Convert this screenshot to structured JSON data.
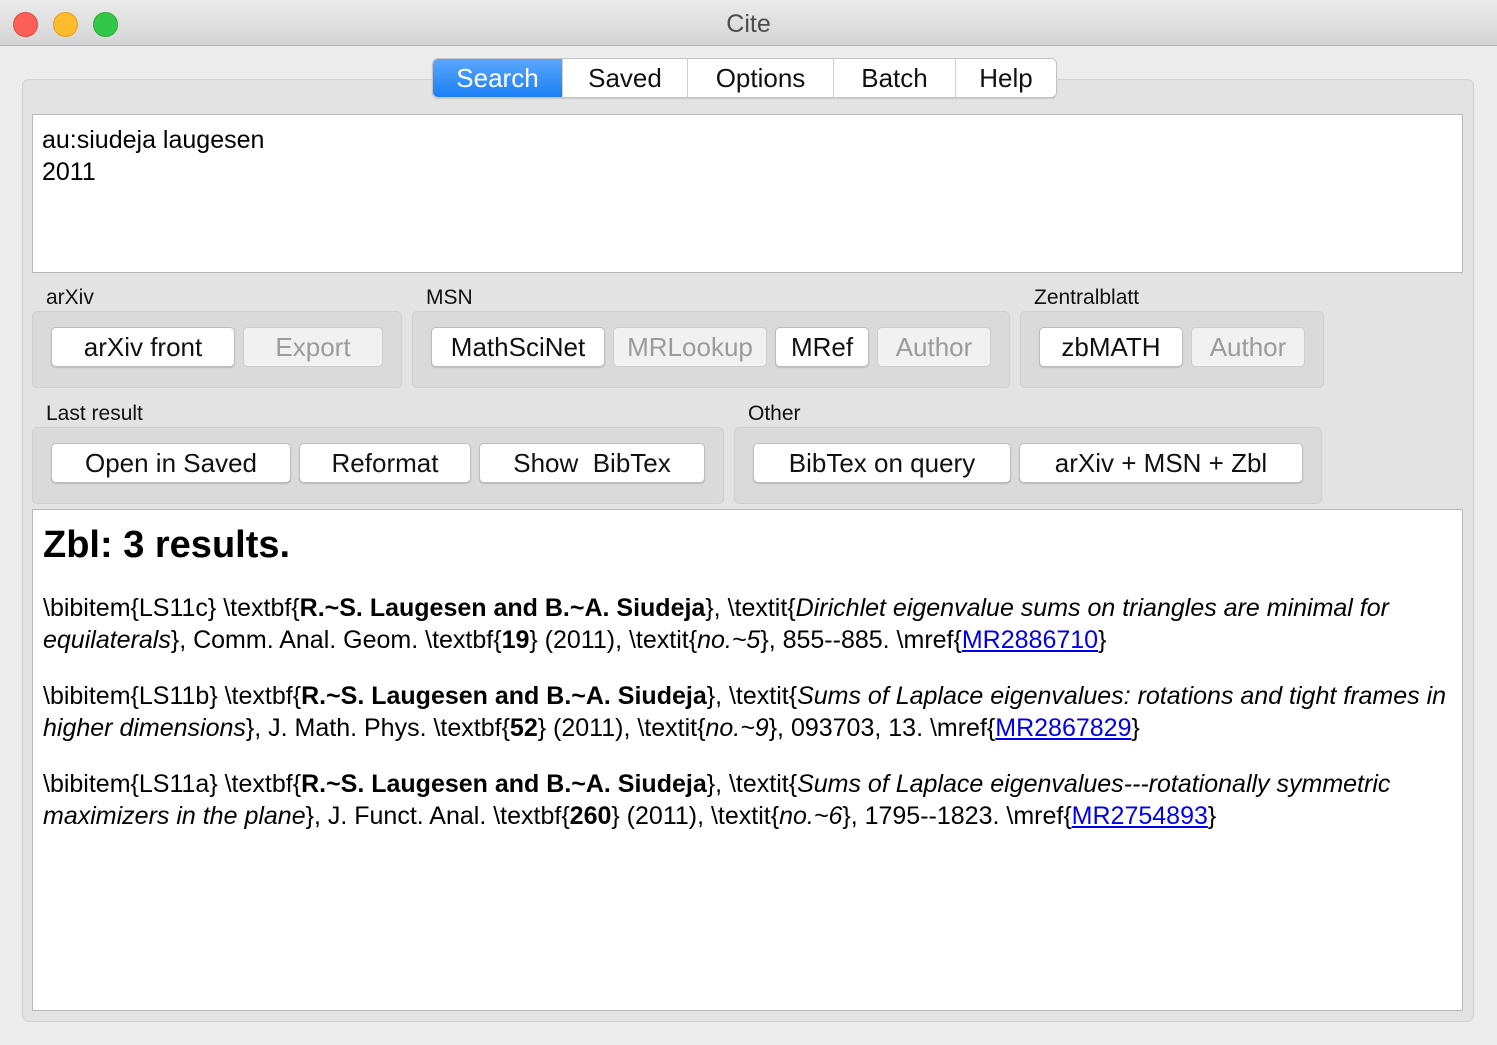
{
  "window": {
    "title": "Cite"
  },
  "tabs": [
    "Search",
    "Saved",
    "Options",
    "Batch",
    "Help"
  ],
  "query": {
    "value": "au:siudeja laugesen\n2011"
  },
  "groups": {
    "arxiv": {
      "label": "arXiv",
      "buttons": [
        "arXiv front",
        "Export"
      ]
    },
    "msn": {
      "label": "MSN",
      "buttons": [
        "MathSciNet",
        "MRLookup",
        "MRef",
        "Author"
      ]
    },
    "zbl": {
      "label": "Zentralblatt",
      "buttons": [
        "zbMATH",
        "Author"
      ]
    },
    "last_result": {
      "label": "Last result",
      "buttons": [
        "Open in Saved",
        "Reformat",
        "Show  BibTex"
      ]
    },
    "other": {
      "label": "Other",
      "buttons": [
        "BibTex on query",
        "arXiv + MSN + Zbl"
      ]
    }
  },
  "results": {
    "heading": "Zbl: 3 results.",
    "entries": [
      {
        "prefix": "\\bibitem{LS11c} \\textbf{",
        "authors": "R.~S. Laugesen and B.~A. Siudeja",
        "mid1": "}, \\textit{",
        "title": "Dirichlet eigenvalue sums on triangles are minimal for equilaterals",
        "mid2": "}, Comm. Anal. Geom. \\textbf{",
        "volume": "19",
        "mid3": "} (2011), \\textit{",
        "issue": "no.~5",
        "mid4": "}, 855--885. \\mref{",
        "mr": "MR2886710",
        "suffix": "}"
      },
      {
        "prefix": "\\bibitem{LS11b} \\textbf{",
        "authors": "R.~S. Laugesen and B.~A. Siudeja",
        "mid1": "}, \\textit{",
        "title": "Sums of Laplace eigenvalues: rotations and tight frames in higher dimensions",
        "mid2": "}, J. Math. Phys. \\textbf{",
        "volume": "52",
        "mid3": "} (2011), \\textit{",
        "issue": "no.~9",
        "mid4": "}, 093703, 13. \\mref{",
        "mr": "MR2867829",
        "suffix": "}"
      },
      {
        "prefix": "\\bibitem{LS11a} \\textbf{",
        "authors": "R.~S. Laugesen and B.~A. Siudeja",
        "mid1": "}, \\textit{",
        "title": "Sums of Laplace eigenvalues---rotationally symmetric maximizers in the plane",
        "mid2": "}, J. Funct. Anal. \\textbf{",
        "volume": "260",
        "mid3": "} (2011), \\textit{",
        "issue": "no.~6",
        "mid4": "}, 1795--1823. \\mref{",
        "mr": "MR2754893",
        "suffix": "}"
      }
    ]
  },
  "colors": {
    "accent": "#1b7ff5",
    "link": "#0000ee"
  }
}
